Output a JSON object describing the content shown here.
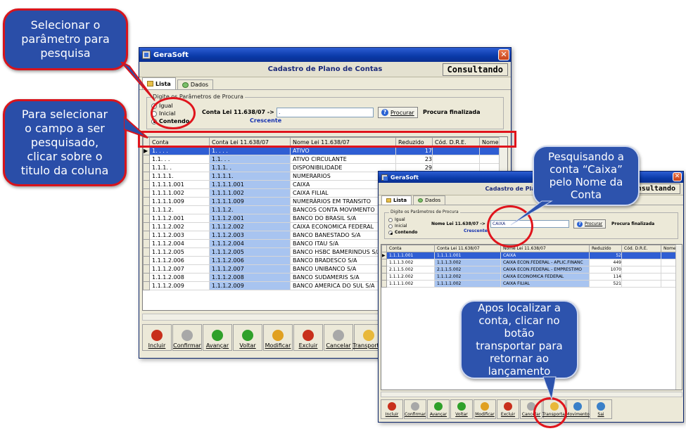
{
  "app_title": "GeraSoft",
  "form_title": "Cadastro de Plano de Contas",
  "mode": "Consultando",
  "tabs": [
    {
      "label": "Lista"
    },
    {
      "label": "Dados"
    }
  ],
  "search_group_label": "Digite os Parâmetros de Procura",
  "radio_options": [
    {
      "label": "Igual"
    },
    {
      "label": "Inicial"
    },
    {
      "label": "Contendo"
    }
  ],
  "search_field_label_main": "Conta Lei 11.638/07 ->",
  "search_value_main": ".",
  "search_field_label_second": "Nome Lei 11.638/07 ->",
  "search_value_second": "CAIXA",
  "order_label": "Crescente",
  "find_button": "Procurar",
  "search_status": "Procura finalizada",
  "columns_main": [
    "Conta",
    "Conta Lei 11.638/07",
    "Nome Lei 11.638/07",
    "Reduzido",
    "Cód. D.R.E.",
    "Nome"
  ],
  "rows_main": [
    [
      "1. . . .",
      "1. . . .",
      "ATIVO",
      "17"
    ],
    [
      "1.1. . .",
      "1.1. . .",
      "ATIVO CIRCULANTE",
      "23"
    ],
    [
      "1.1.1. .",
      "1.1.1. .",
      "DISPONIBILIDADE",
      "29"
    ],
    [
      "1.1.1.1.",
      "1.1.1.1.",
      "NUMERARIOS",
      ""
    ],
    [
      "1.1.1.1.001",
      "1.1.1.1.001",
      "CAIXA",
      ""
    ],
    [
      "1.1.1.1.002",
      "1.1.1.1.002",
      "CAIXA FILIAL",
      ""
    ],
    [
      "1.1.1.1.009",
      "1.1.1.1.009",
      "NUMERÁRIOS EM TRANSITO",
      ""
    ],
    [
      "1.1.1.2.",
      "1.1.1.2.",
      "BANCOS CONTA MOVIMENTO",
      ""
    ],
    [
      "1.1.1.2.001",
      "1.1.1.2.001",
      "BANCO DO BRASIL S/A",
      ""
    ],
    [
      "1.1.1.2.002",
      "1.1.1.2.002",
      "CAIXA ECONOMICA FEDERAL",
      ""
    ],
    [
      "1.1.1.2.003",
      "1.1.1.2.003",
      "BANCO BANESTADO S/A",
      ""
    ],
    [
      "1.1.1.2.004",
      "1.1.1.2.004",
      "BANCO ITAU S/A",
      ""
    ],
    [
      "1.1.1.2.005",
      "1.1.1.2.005",
      "BANCO HSBC BAMERINDUS S/A",
      ""
    ],
    [
      "1.1.1.2.006",
      "1.1.1.2.006",
      "BANCO BRADESCO S/A",
      ""
    ],
    [
      "1.1.1.2.007",
      "1.1.1.2.007",
      "BANCO UNIBANCO S/A",
      ""
    ],
    [
      "1.1.1.2.008",
      "1.1.1.2.008",
      "BANCO SUDAMERIS S/A",
      ""
    ],
    [
      "1.1.1.2.009",
      "1.1.1.2.009",
      "BANCO AMERICA DO SUL S/A",
      ""
    ]
  ],
  "rows_second": [
    [
      "1.1.1.1.001",
      "1.1.1.1.001",
      "CAIXA",
      "52"
    ],
    [
      "1.1.1.3.002",
      "1.1.1.3.002",
      "CAIXA ECON.FEDERAL - APLIC.FINANC",
      "449"
    ],
    [
      "2.1.1.5.002",
      "2.1.1.5.002",
      "CAIXA ECON.FEDERAL - EMPRESTIMO",
      "1070"
    ],
    [
      "1.1.1.2.002",
      "1.1.1.2.002",
      "CAIXA ECONOMICA FEDERAL",
      "114"
    ],
    [
      "1.1.1.1.002",
      "1.1.1.1.002",
      "CAIXA FILIAL",
      "521"
    ]
  ],
  "toolbar_main": [
    {
      "label": "Incluir",
      "icon": "include-icon",
      "color": "#c8301c"
    },
    {
      "label": "Confirmar",
      "icon": "confirm-icon",
      "color": "#a8a8a8"
    },
    {
      "label": "Avançar",
      "icon": "forward-icon",
      "color": "#2fa02a"
    },
    {
      "label": "Voltar",
      "icon": "back-icon",
      "color": "#2fa02a"
    },
    {
      "label": "Modificar",
      "icon": "pencil-icon",
      "color": "#e0a020"
    },
    {
      "label": "Excluir",
      "icon": "delete-icon",
      "color": "#c8301c"
    },
    {
      "label": "Cancelar",
      "icon": "cancel-icon",
      "color": "#a8a8a8"
    },
    {
      "label": "Transportar",
      "icon": "transport-icon",
      "color": "#e8b83a"
    },
    {
      "label": "Mo",
      "icon": "move-icon",
      "color": "#3a80c8"
    }
  ],
  "toolbar_second": [
    {
      "label": "Incluir",
      "icon": "include-icon",
      "color": "#c8301c"
    },
    {
      "label": "Confirmar",
      "icon": "confirm-icon",
      "color": "#a8a8a8"
    },
    {
      "label": "Avançar",
      "icon": "forward-icon",
      "color": "#2fa02a"
    },
    {
      "label": "Voltar",
      "icon": "back-icon",
      "color": "#2fa02a"
    },
    {
      "label": "Modificar",
      "icon": "pencil-icon",
      "color": "#e0a020"
    },
    {
      "label": "Excluir",
      "icon": "delete-icon",
      "color": "#c8301c"
    },
    {
      "label": "Cancelar",
      "icon": "cancel-icon",
      "color": "#a8a8a8"
    },
    {
      "label": "Transportar",
      "icon": "transport-icon",
      "color": "#e8b83a"
    },
    {
      "label": "Movimento",
      "icon": "move-icon",
      "color": "#3a80c8"
    },
    {
      "label": "Sai",
      "icon": "exit-icon",
      "color": "#3a80c8"
    }
  ],
  "callouts": {
    "select_param": "Selecionar o\nparâmetro para\npesquisa",
    "select_column": "Para selecionar\no campo a ser\npesquisado,\nclicar sobre o\ntitulo da coluna",
    "searching": "Pesquisando a\nconta “Caixa”\npelo Nome da\nConta",
    "transport": "Apos localizar a\nconta, clicar no\nbotão\ntransportar para\nretornar  ao\nlançamento"
  }
}
